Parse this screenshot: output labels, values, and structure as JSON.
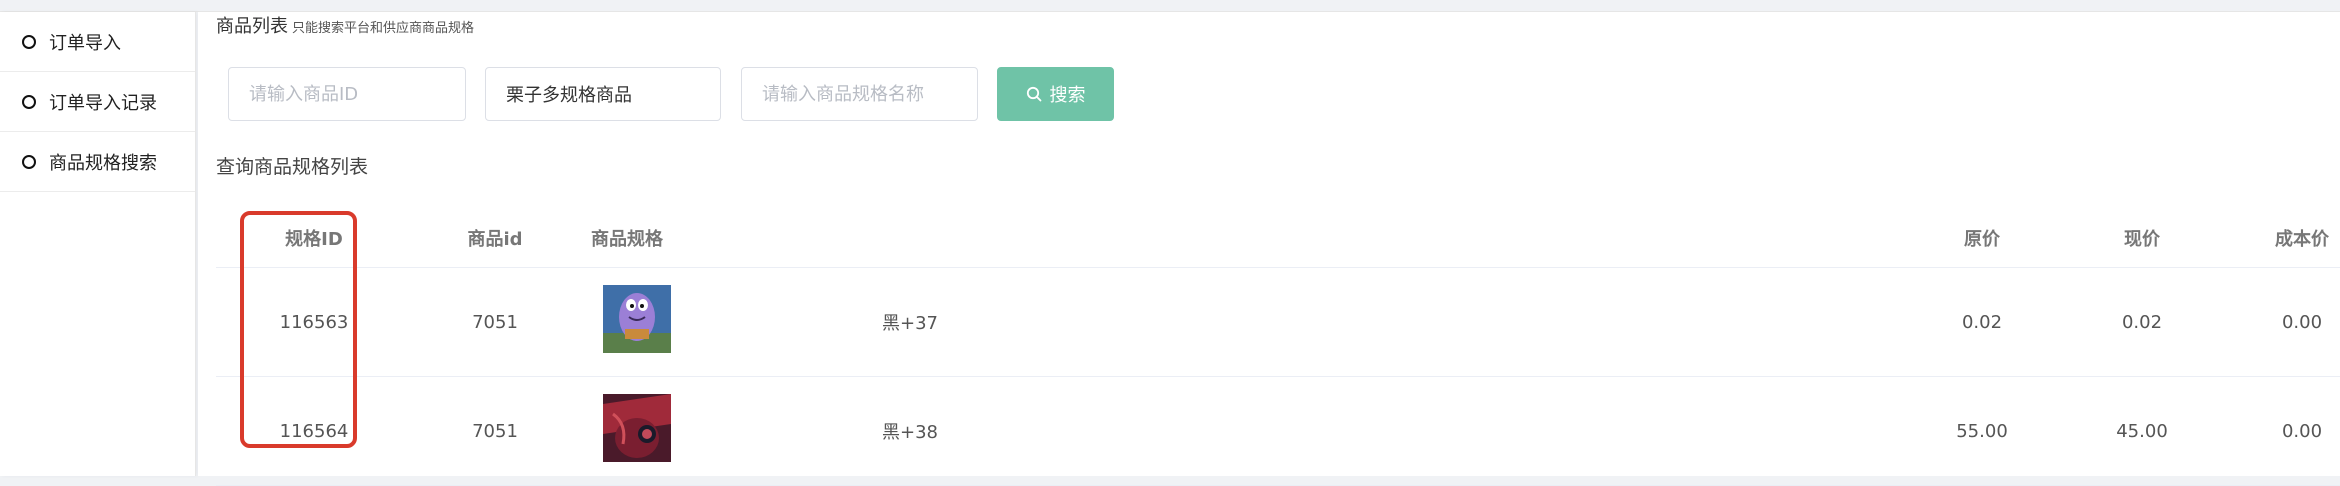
{
  "sidebar": {
    "items": [
      {
        "label": "订单导入"
      },
      {
        "label": "订单导入记录"
      },
      {
        "label": "商品规格搜索"
      }
    ]
  },
  "header": {
    "title": "商品列表",
    "subtitle": "只能搜索平台和供应商商品规格"
  },
  "search": {
    "product_id_placeholder": "请输入商品ID",
    "product_name_value": "栗子多规格商品",
    "spec_name_placeholder": "请输入商品规格名称",
    "button_label": "搜索"
  },
  "section_title": "查询商品规格列表",
  "table": {
    "headers": {
      "spec_id": "规格ID",
      "product_id": "商品id",
      "spec": "商品规格",
      "original_price": "原价",
      "current_price": "现价",
      "cost_price": "成本价"
    },
    "rows": [
      {
        "spec_id": "116563",
        "product_id": "7051",
        "spec": "黑+37",
        "original_price": "0.02",
        "current_price": "0.02",
        "cost_price": "0.00"
      },
      {
        "spec_id": "116564",
        "product_id": "7051",
        "spec": "黑+38",
        "original_price": "55.00",
        "current_price": "45.00",
        "cost_price": "0.00"
      }
    ]
  },
  "colors": {
    "accent": "#6fc3a7",
    "highlight": "#d93a2b"
  }
}
